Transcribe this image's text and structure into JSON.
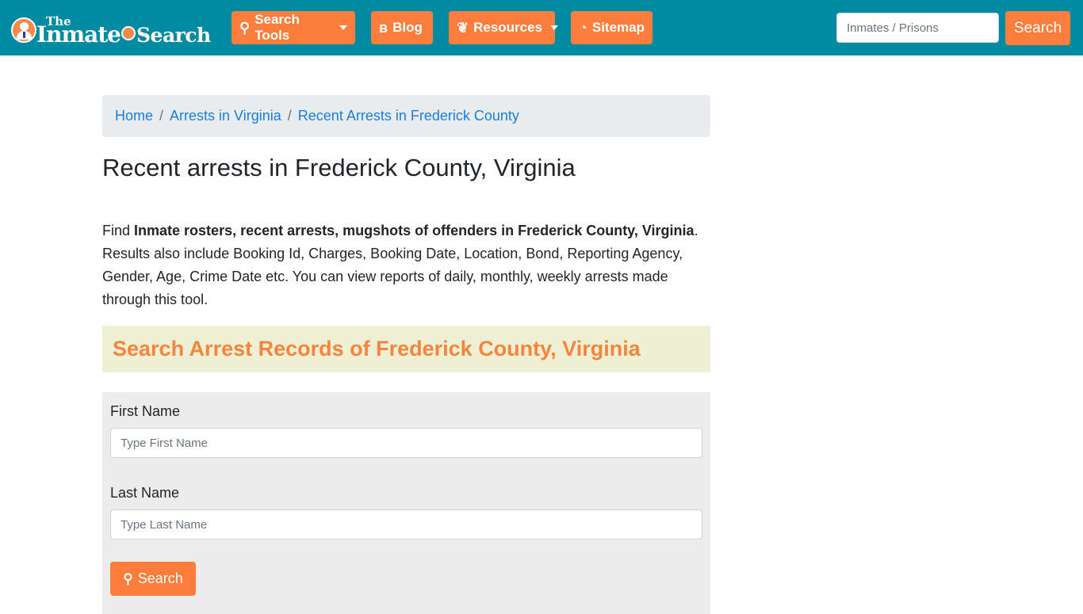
{
  "header": {
    "logo": {
      "the": "The",
      "inmate": "Inmate",
      "search": "Search"
    },
    "nav": [
      {
        "label": "Search Tools",
        "icon": "search-icon",
        "glyph": "🔍",
        "dropdown": true
      },
      {
        "label": "Blog",
        "icon": "blog-icon",
        "glyph": "b",
        "dropdown": false
      },
      {
        "label": "Resources",
        "icon": "leaf-icon",
        "glyph": "❦",
        "dropdown": true
      },
      {
        "label": "Sitemap",
        "icon": "rss-icon",
        "glyph": "◔",
        "dropdown": false
      }
    ],
    "search": {
      "placeholder": "Inmates / Prisons",
      "button_label": "Search"
    }
  },
  "breadcrumb": [
    {
      "label": "Home"
    },
    {
      "label": "Arrests in Virginia"
    },
    {
      "label": "Recent Arrests in Frederick County"
    }
  ],
  "breadcrumb_separator": "/",
  "page_title": "Recent arrests in Frederick County, Virginia",
  "intro": {
    "prefix": "Find ",
    "bold": "Inmate rosters, recent arrests, mugshots of offenders in Frederick County, Virginia",
    "suffix": ". Results also include Booking Id, Charges, Booking Date, Location, Bond, Reporting Agency, Gender, Age, Crime Date etc. You can view reports of daily, monthly, weekly arrests made through this tool."
  },
  "search_section": {
    "heading": "Search Arrest Records of Frederick County, Virginia",
    "first_name_label": "First Name",
    "first_name_placeholder": "Type First Name",
    "first_name_value": "",
    "last_name_label": "Last Name",
    "last_name_placeholder": "Type Last Name",
    "last_name_value": "",
    "button_label": "Search",
    "button_glyph": "🔍"
  },
  "colors": {
    "navbar": "#008ba3",
    "accent": "#fd7e3c",
    "link": "#1a7ed8",
    "heading_band": "#efefd4",
    "form_bg": "#ececec"
  }
}
